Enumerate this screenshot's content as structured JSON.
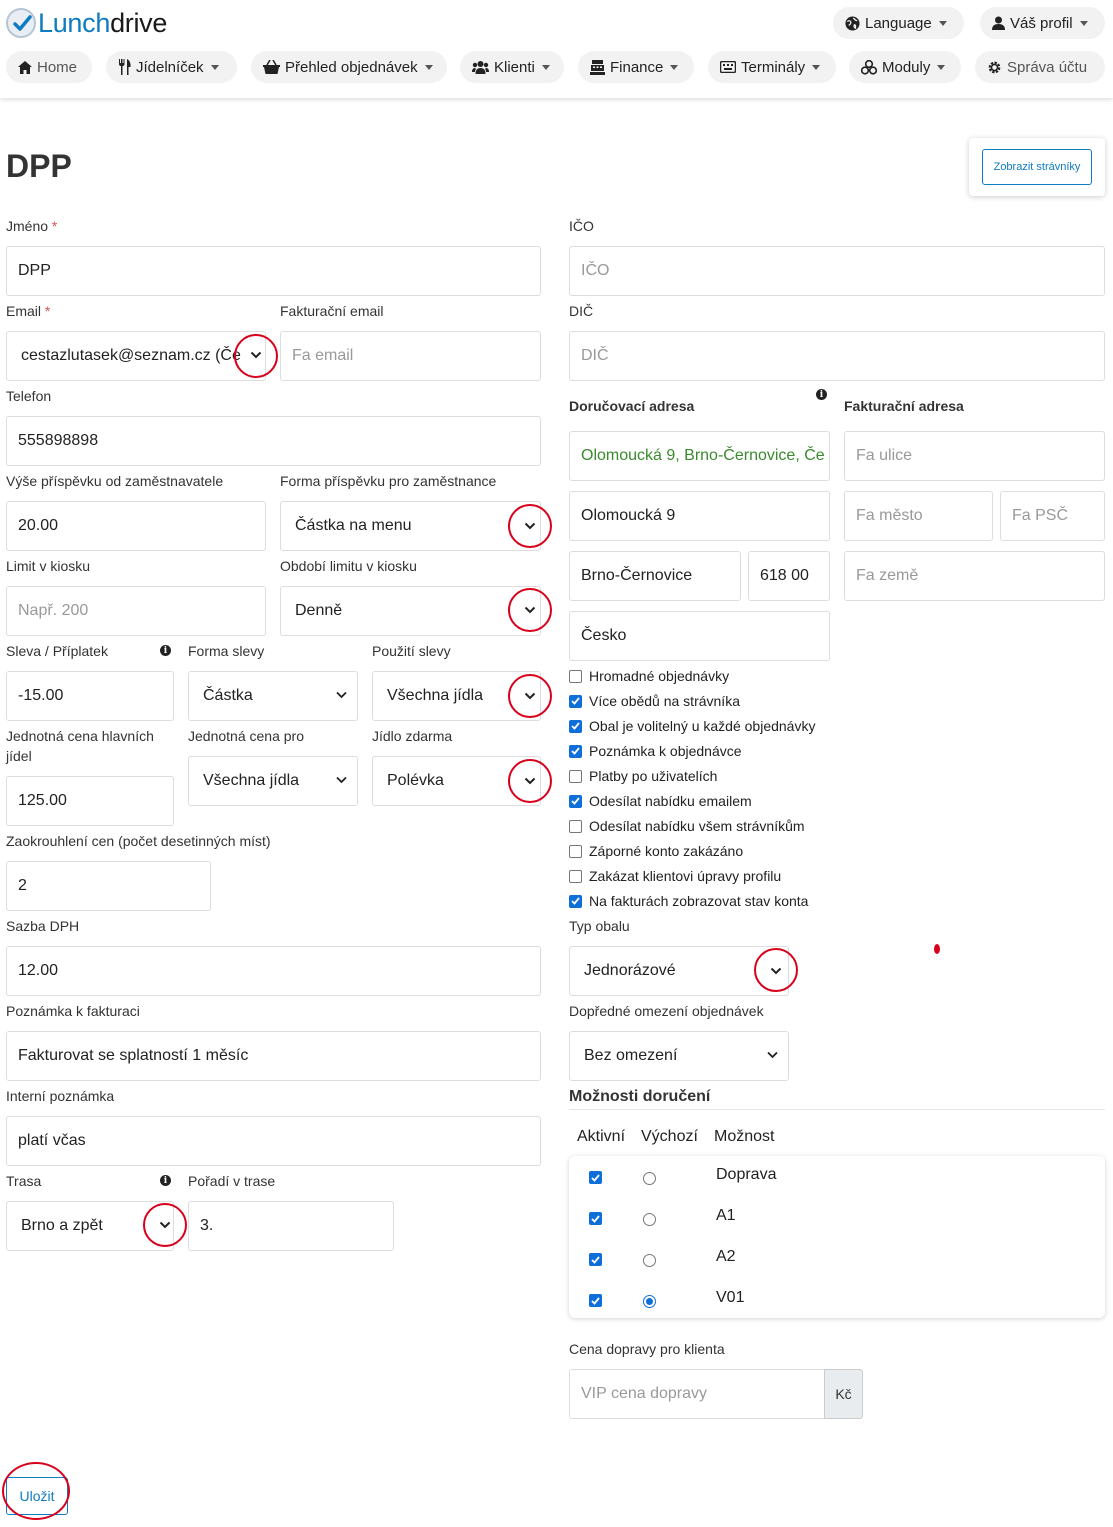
{
  "header": {
    "logo_part1": "Lunch",
    "logo_part2": "drive",
    "language": "Language",
    "profile": "Váš profil",
    "nav": {
      "home": "Home",
      "menu": "Jídelníček",
      "orders": "Přehled objednávek",
      "clients": "Klienti",
      "finance": "Finance",
      "terminals": "Terminály",
      "modules": "Moduly",
      "account": "Správa účtu"
    }
  },
  "page": {
    "title": "DPP",
    "show_diners_button": "Zobrazit strávníky",
    "save_button": "Uložit"
  },
  "form": {
    "name_label": "Jméno",
    "name_value": "DPP",
    "email_label": "Email",
    "email_value": "cestazlutasek@seznam.cz (Če",
    "invoice_email_label": "Fakturační email",
    "invoice_email_placeholder": "Fa email",
    "phone_label": "Telefon",
    "phone_value": "555898898",
    "employer_contribution_label": "Výše příspěvku od zaměstnavatele",
    "employer_contribution_value": "20.00",
    "contribution_form_label": "Forma příspěvku pro zaměstnance",
    "contribution_form_value": "Částka na menu",
    "kiosk_limit_label": "Limit v kiosku",
    "kiosk_limit_placeholder": "Např. 200",
    "kiosk_period_label": "Období limitu v kiosku",
    "kiosk_period_value": "Denně",
    "discount_label": "Sleva / Příplatek",
    "discount_value": "-15.00",
    "discount_form_label": "Forma slevy",
    "discount_form_value": "Částka",
    "discount_use_label": "Použití slevy",
    "discount_use_value": "Všechna jídla",
    "unit_price_label": "Jednotná cena hlavních jídel",
    "unit_price_value": "125.00",
    "unit_price_for_label": "Jednotná cena pro",
    "unit_price_for_value": "Všechna jídla",
    "free_meal_label": "Jídlo zdarma",
    "free_meal_value": "Polévka",
    "rounding_label": "Zaokrouhlení cen (počet desetinných míst)",
    "rounding_value": "2",
    "vat_label": "Sazba DPH",
    "vat_value": "12.00",
    "invoice_note_label": "Poznámka k fakturaci",
    "invoice_note_value": "Fakturovat se splatností 1 měsíc",
    "internal_note_label": "Interní poznámka",
    "internal_note_value": "platí včas",
    "route_label": "Trasa",
    "route_value": "Brno a zpět",
    "route_order_label": "Pořadí v trase",
    "route_order_value": "3.",
    "ico_label": "IČO",
    "ico_placeholder": "IČO",
    "dic_label": "DIČ",
    "dic_placeholder": "DIČ",
    "delivery_address_label": "Doručovací adresa",
    "invoice_address_label": "Fakturační adresa",
    "delivery_full": "Olomoucká 9, Brno-Černovice, Če",
    "delivery_street": "Olomoucká 9",
    "delivery_city": "Brno-Černovice",
    "delivery_zip": "618 00",
    "delivery_country": "Česko",
    "fa_street_placeholder": "Fa ulice",
    "fa_city_placeholder": "Fa město",
    "fa_zip_placeholder": "Fa PSČ",
    "fa_country_placeholder": "Fa země",
    "checkboxes": [
      {
        "label": "Hromadné objednávky",
        "checked": false
      },
      {
        "label": "Více obědů na strávníka",
        "checked": true
      },
      {
        "label": "Obal je volitelný u každé objednávky",
        "checked": true
      },
      {
        "label": "Poznámka k objednávce",
        "checked": true
      },
      {
        "label": "Platby po uživatelích",
        "checked": false
      },
      {
        "label": "Odesílat nabídku emailem",
        "checked": true
      },
      {
        "label": "Odesílat nabídku všem strávníkům",
        "checked": false
      },
      {
        "label": "Záporné konto zakázáno",
        "checked": false
      },
      {
        "label": "Zakázat klientovi úpravy profilu",
        "checked": false
      },
      {
        "label": "Na fakturách zobrazovat stav konta",
        "checked": true
      }
    ],
    "packaging_label": "Typ obalu",
    "packaging_value": "Jednorázové",
    "order_limit_label": "Dopředné omezení objednávek",
    "order_limit_value": "Bez omezení",
    "delivery_options_title": "Možnosti doručení",
    "delivery_headers": {
      "active": "Aktivní",
      "default": "Výchozí",
      "option": "Možnost"
    },
    "delivery_options": [
      {
        "name": "Doprava",
        "active": true,
        "default": false
      },
      {
        "name": "A1",
        "active": true,
        "default": false
      },
      {
        "name": "A2",
        "active": true,
        "default": false
      },
      {
        "name": "V01",
        "active": true,
        "default": true
      }
    ],
    "delivery_price_label": "Cena dopravy pro klienta",
    "delivery_price_placeholder": "VIP cena dopravy",
    "currency": "Kč"
  }
}
